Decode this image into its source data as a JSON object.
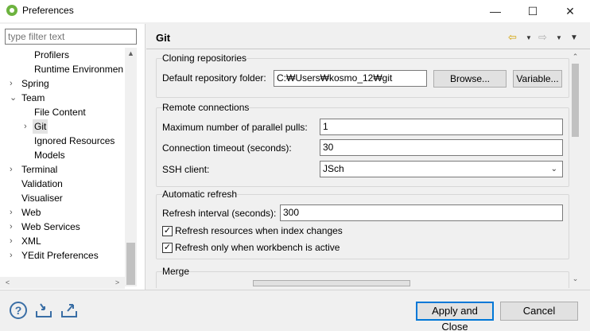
{
  "window": {
    "title": "Preferences",
    "minimize": "—",
    "maximize": "☐",
    "close": "✕"
  },
  "filter": {
    "placeholder": "type filter text"
  },
  "tree": {
    "items": [
      {
        "label": "Profilers"
      },
      {
        "label": "Runtime Environmen"
      },
      {
        "label": "Spring"
      },
      {
        "label": "Team"
      },
      {
        "label": "File Content"
      },
      {
        "label": "Git"
      },
      {
        "label": "Ignored Resources"
      },
      {
        "label": "Models"
      },
      {
        "label": "Terminal"
      },
      {
        "label": "Validation"
      },
      {
        "label": "Visualiser"
      },
      {
        "label": "Web"
      },
      {
        "label": "Web Services"
      },
      {
        "label": "XML"
      },
      {
        "label": "YEdit Preferences"
      }
    ]
  },
  "page": {
    "title": "Git"
  },
  "cloning": {
    "title": "Cloning repositories",
    "folder_label": "Default repository folder:",
    "folder_value": "C:₩Users₩kosmo_12₩git",
    "browse": "Browse...",
    "variable": "Variable..."
  },
  "remote": {
    "title": "Remote connections",
    "pulls_label": "Maximum number of parallel pulls:",
    "pulls_value": "1",
    "timeout_label": "Connection timeout (seconds):",
    "timeout_value": "30",
    "ssh_label": "SSH client:",
    "ssh_value": "JSch"
  },
  "refresh": {
    "title": "Automatic refresh",
    "interval_label": "Refresh interval (seconds):",
    "interval_value": "300",
    "index_label": "Refresh resources when index changes",
    "index_checked": true,
    "active_label": "Refresh only when workbench is active",
    "active_checked": true
  },
  "merge": {
    "title": "Merge"
  },
  "buttons": {
    "apply_close": "Apply and Close",
    "cancel": "Cancel"
  }
}
